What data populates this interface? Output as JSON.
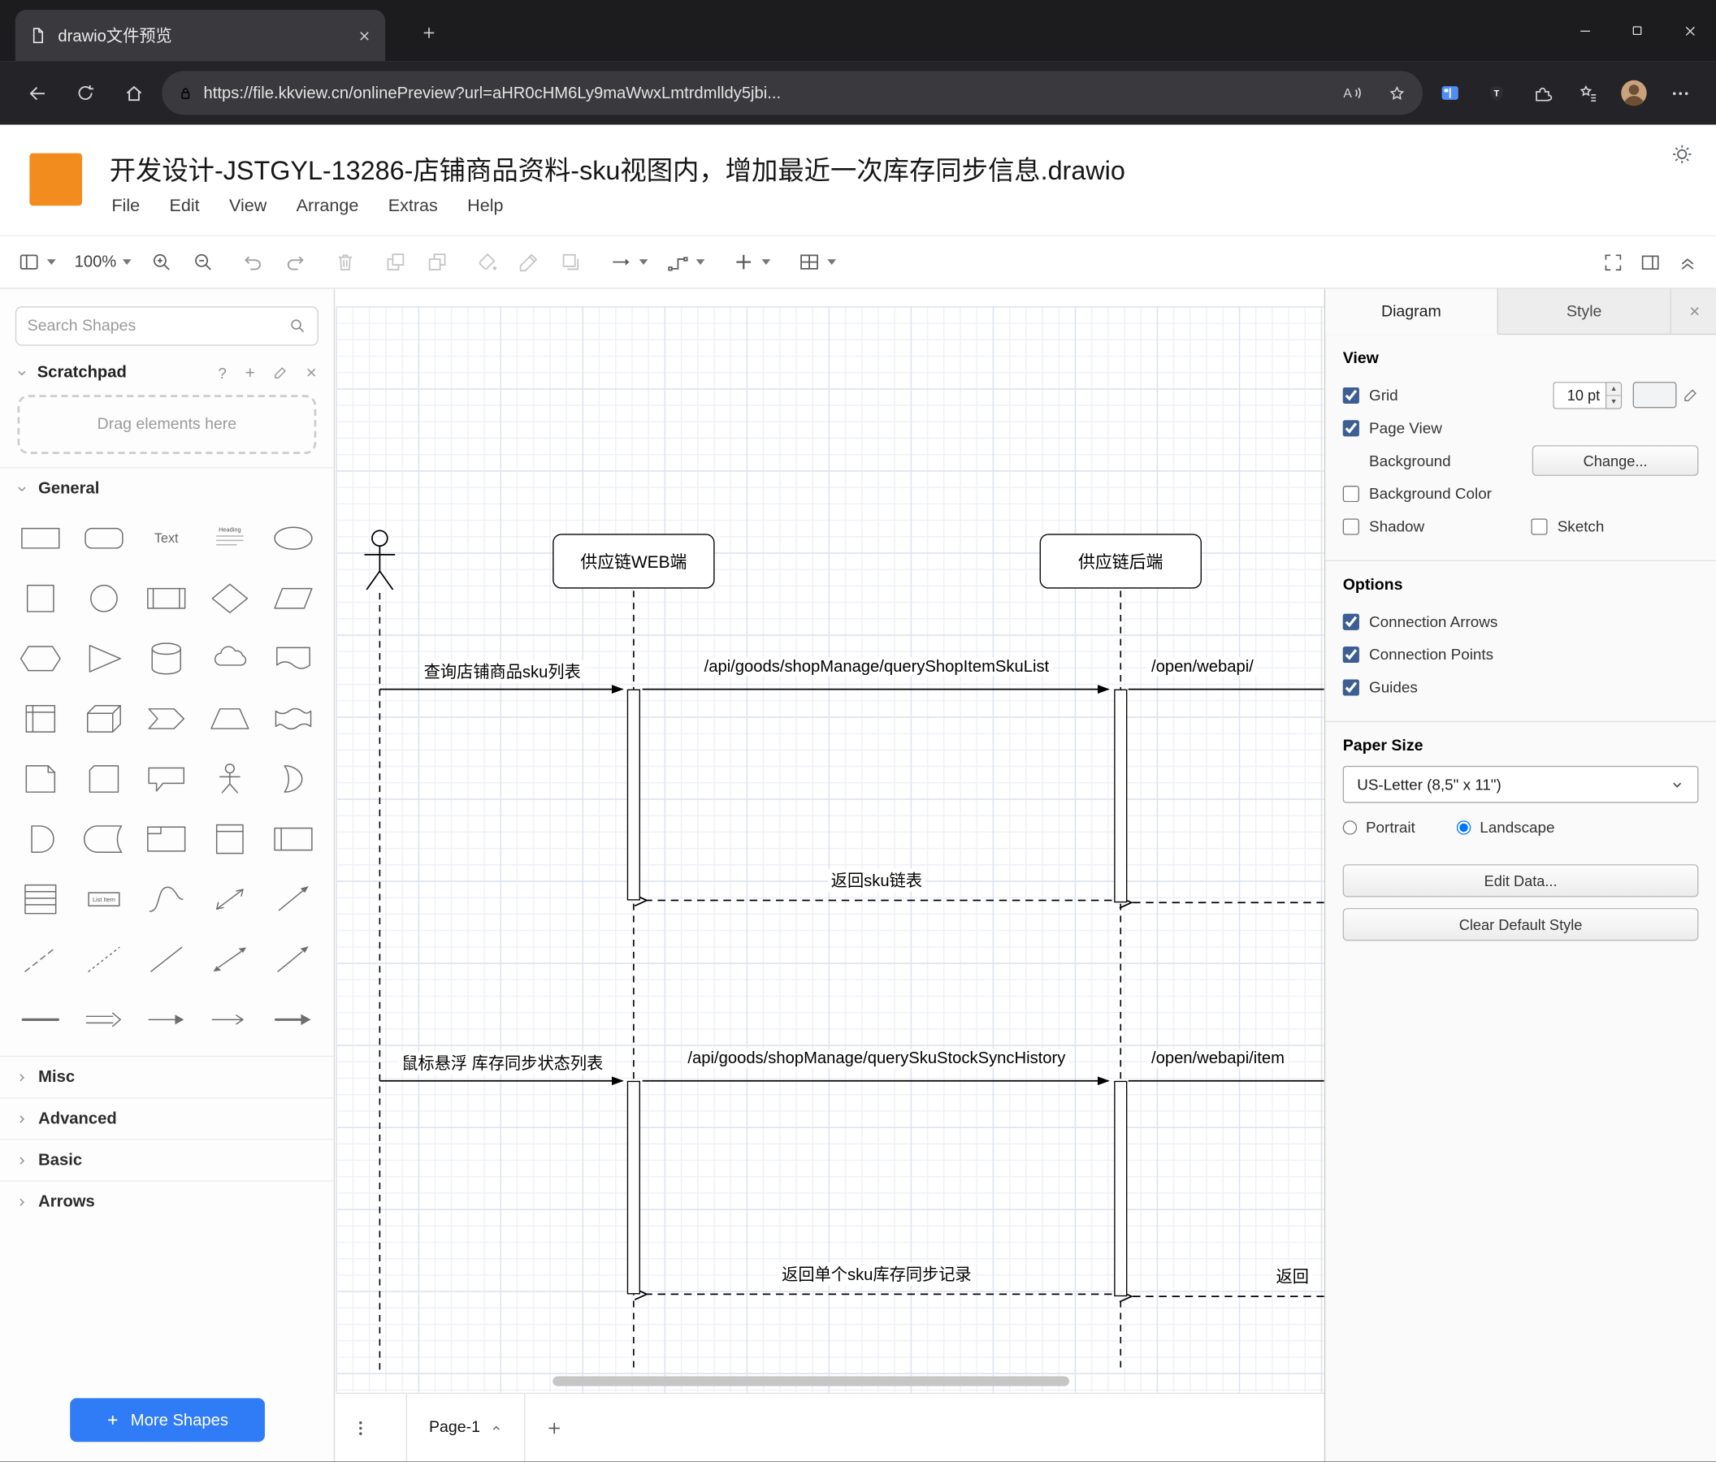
{
  "colors": {
    "brand_orange": "#f28c1f",
    "more_shapes_blue": "#2f7cf6",
    "check_accent": "#3c5e93"
  },
  "browser": {
    "tab_title": "drawio文件预览",
    "url": "https://file.kkview.cn/onlinePreview?url=aHR0cHM6Ly9maWwxLmtrdmlldy5jbi..."
  },
  "app": {
    "title": "开发设计-JSTGYL-13286-店铺商品资料-sku视图内，增加最近一次库存同步信息.drawio",
    "menus": [
      "File",
      "Edit",
      "View",
      "Arrange",
      "Extras",
      "Help"
    ],
    "toolbar": {
      "zoom_level": "100%"
    }
  },
  "sidebar": {
    "search_placeholder": "Search Shapes",
    "scratchpad_label": "Scratchpad",
    "drag_hint": "Drag elements here",
    "section_general": "General",
    "collapsed_sections": [
      "Misc",
      "Advanced",
      "Basic",
      "Arrows"
    ],
    "more_shapes_label": "More Shapes",
    "shapes": [
      "rectangle",
      "rounded-rectangle",
      "text",
      "textbox",
      "ellipse",
      "square",
      "circle",
      "process",
      "diamond",
      "parallelogram",
      "hexagon",
      "triangle",
      "cylinder",
      "cloud",
      "document",
      "internal-storage",
      "cube",
      "step",
      "trapezoid",
      "tape",
      "note",
      "card",
      "callout",
      "actor",
      "or",
      "and",
      "data-storage",
      "container",
      "vertical-container",
      "horizontal-container",
      "list",
      "list-item",
      "curve",
      "bidirectional-arrow",
      "arrow",
      "dashed-line",
      "dotted-line",
      "line",
      "bidirectional-connector",
      "directional-connector",
      "horizontal-line",
      "link",
      "arrow-connector",
      "open-arrow",
      "filled-arrow"
    ]
  },
  "canvas": {
    "participants": [
      "供应链WEB端",
      "供应链后端"
    ],
    "messages": [
      "查询店铺商品sku列表",
      "/api/goods/shopManage/queryShopItemSkuList",
      "/open/webapi/",
      "返回sku链表",
      "鼠标悬浮 库存同步状态列表",
      "/api/goods/shopManage/querySkuStockSyncHistory",
      "/open/webapi/item",
      "返回单个sku库存同步记录",
      "返回"
    ],
    "page_tab": "Page-1"
  },
  "format_panel": {
    "tabs": [
      "Diagram",
      "Style"
    ],
    "view": {
      "heading": "View",
      "grid": "Grid",
      "grid_size": "10 pt",
      "page_view": "Page View",
      "background": "Background",
      "change_button": "Change...",
      "background_color": "Background Color",
      "shadow": "Shadow",
      "sketch": "Sketch"
    },
    "options": {
      "heading": "Options",
      "connection_arrows": "Connection Arrows",
      "connection_points": "Connection Points",
      "guides": "Guides"
    },
    "paper": {
      "heading": "Paper Size",
      "size": "US-Letter (8,5\" x 11\")",
      "portrait": "Portrait",
      "landscape": "Landscape"
    },
    "buttons": {
      "edit_data": "Edit Data...",
      "clear_default_style": "Clear Default Style"
    },
    "checks": {
      "grid": true,
      "page_view": true,
      "background_color": false,
      "shadow": false,
      "sketch": false,
      "connection_arrows": true,
      "connection_points": true,
      "guides": true,
      "portrait": false,
      "landscape": true
    }
  }
}
